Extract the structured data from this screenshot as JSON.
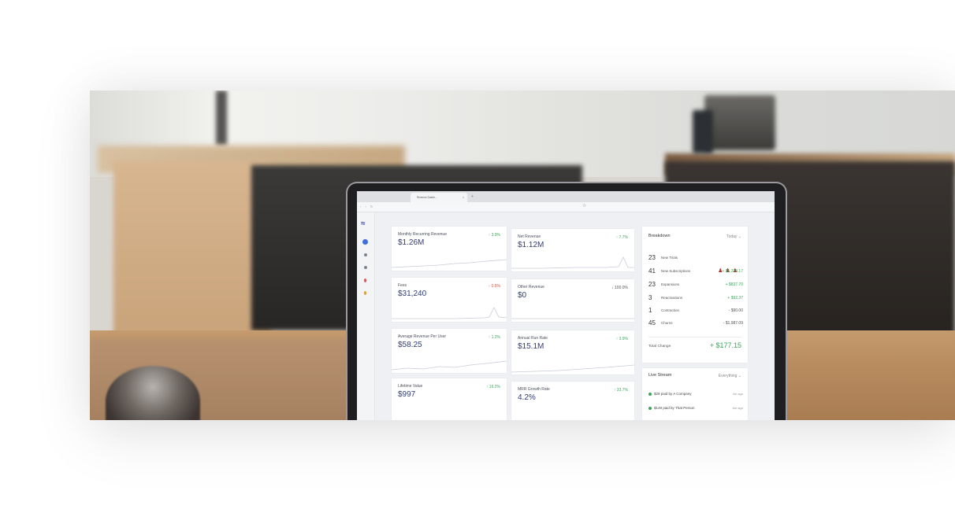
{
  "browser": {
    "tab_title": "Revenue Dashb...",
    "tab_close": "×",
    "tab_new": "+",
    "nav": "‹ › ↻",
    "bookmark_icon": "☆"
  },
  "sidebar": {
    "logo": "≈"
  },
  "metrics": [
    {
      "label": "Monthly Recurring Revenue",
      "value": "$1.26M",
      "change": "↑ 3.9%",
      "trend": "up"
    },
    {
      "label": "Net Revenue",
      "value": "$1.12M",
      "change": "↑ 7.7%",
      "trend": "up"
    },
    {
      "label": "Fees",
      "value": "$31,240",
      "change": "↑ 0.5%",
      "trend": "down"
    },
    {
      "label": "Other Revenue",
      "value": "$0",
      "change": "↓ 100.0%",
      "trend": "neutral"
    },
    {
      "label": "Average Revenue Per User",
      "value": "$58.25",
      "change": "↑ 1.2%",
      "trend": "up"
    },
    {
      "label": "Annual Run Rate",
      "value": "$15.1M",
      "change": "↑ 3.9%",
      "trend": "up"
    },
    {
      "label": "Lifetime Value",
      "value": "$997",
      "change": "↑ 16.2%",
      "trend": "up"
    },
    {
      "label": "MRR Growth Rate",
      "value": "4.2%",
      "change": "↑ 33.7%",
      "trend": "up"
    }
  ],
  "breakdown": {
    "title": "Breakdown",
    "period": "Today ⌄",
    "rows": [
      {
        "count": "23",
        "label": "New Trials",
        "amount": ""
      },
      {
        "count": "41",
        "label": "New Subscriptions",
        "amount": "+ $1,324.17"
      },
      {
        "count": "23",
        "label": "Expansions",
        "amount": "+ $837.70"
      },
      {
        "count": "3",
        "label": "Reactivations",
        "amount": "+ $92.37"
      },
      {
        "count": "1",
        "label": "Contraction",
        "amount": "- $90.00"
      },
      {
        "count": "45",
        "label": "Churns",
        "amount": "- $1,987.09"
      }
    ],
    "total_label": "Total Change",
    "total_value": "+ $177.15"
  },
  "live_stream": {
    "title": "Live Stream",
    "filter": "Everything ⌄",
    "items": [
      {
        "text": "$29 paid by A Company",
        "ago": "4m ago"
      },
      {
        "text": "$149 paid by That Person",
        "ago": "8m ago"
      }
    ]
  },
  "colors": {
    "accent": "#2f3c78",
    "positive": "#3aa757",
    "negative": "#d24b3c"
  }
}
